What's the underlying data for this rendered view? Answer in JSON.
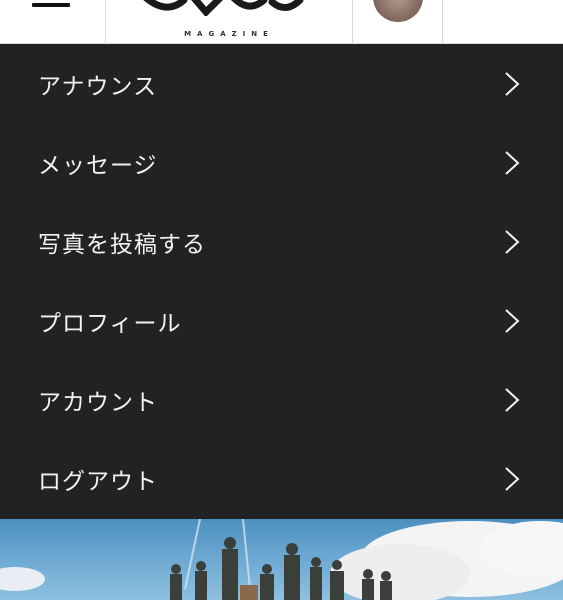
{
  "header": {
    "logo_subtitle": "MAGAZINE"
  },
  "menu": {
    "items": [
      {
        "label": "アナウンス"
      },
      {
        "label": "メッセージ"
      },
      {
        "label": "写真を投稿する"
      },
      {
        "label": "プロフィール"
      },
      {
        "label": "アカウント"
      },
      {
        "label": "ログアウト"
      }
    ]
  },
  "colors": {
    "panel_bg": "#222222",
    "menu_text": "#f2f2f2",
    "accent_teal": "#1fa3b8"
  }
}
